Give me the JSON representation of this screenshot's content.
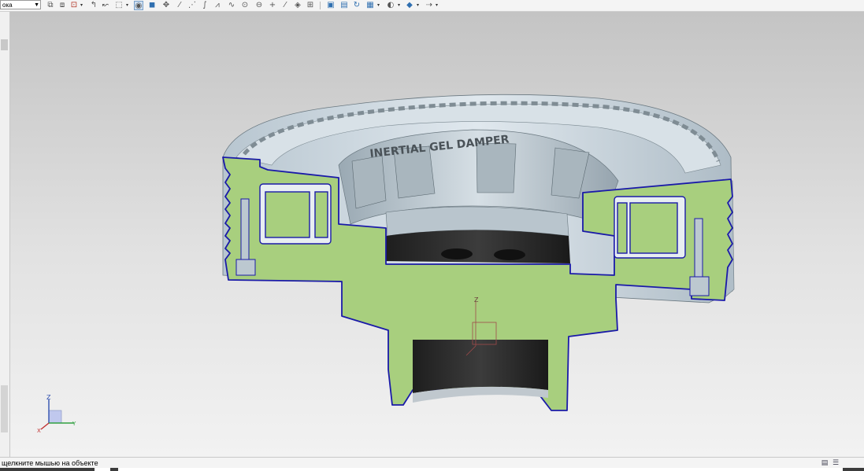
{
  "toolbar": {
    "filter_combo_value": "ока",
    "icons": [
      "select-edge-icon",
      "select-face-icon",
      "snap-icon",
      "curve-rule-icon",
      "sketch-curve-icon",
      "selection-box-icon",
      "shaded-view-icon",
      "cube-view-icon",
      "move-icon",
      "line-icon",
      "tangent-icon",
      "spline-icon",
      "polygon-icon",
      "circle-icon",
      "point-icon",
      "diagonal-icon",
      "plane-icon",
      "snap-point-icon",
      "toggle-icon",
      "layer-icon",
      "scene-icon",
      "refresh-icon",
      "layout-icon",
      "render-style-icon",
      "view-orient-icon",
      "view-cube-icon",
      "more-icon"
    ]
  },
  "viewport": {
    "part_engraving": "INERTIAL GEL DAMPER",
    "triad_labels": {
      "z": "Z",
      "x": "X",
      "y": "Y"
    },
    "section_color": "#a8cf7e",
    "edge_color": "#1a1aa8",
    "body_color": "#c8d4dc",
    "dark_color": "#303030"
  },
  "status": {
    "text": "щелкните мышью на объекте"
  }
}
